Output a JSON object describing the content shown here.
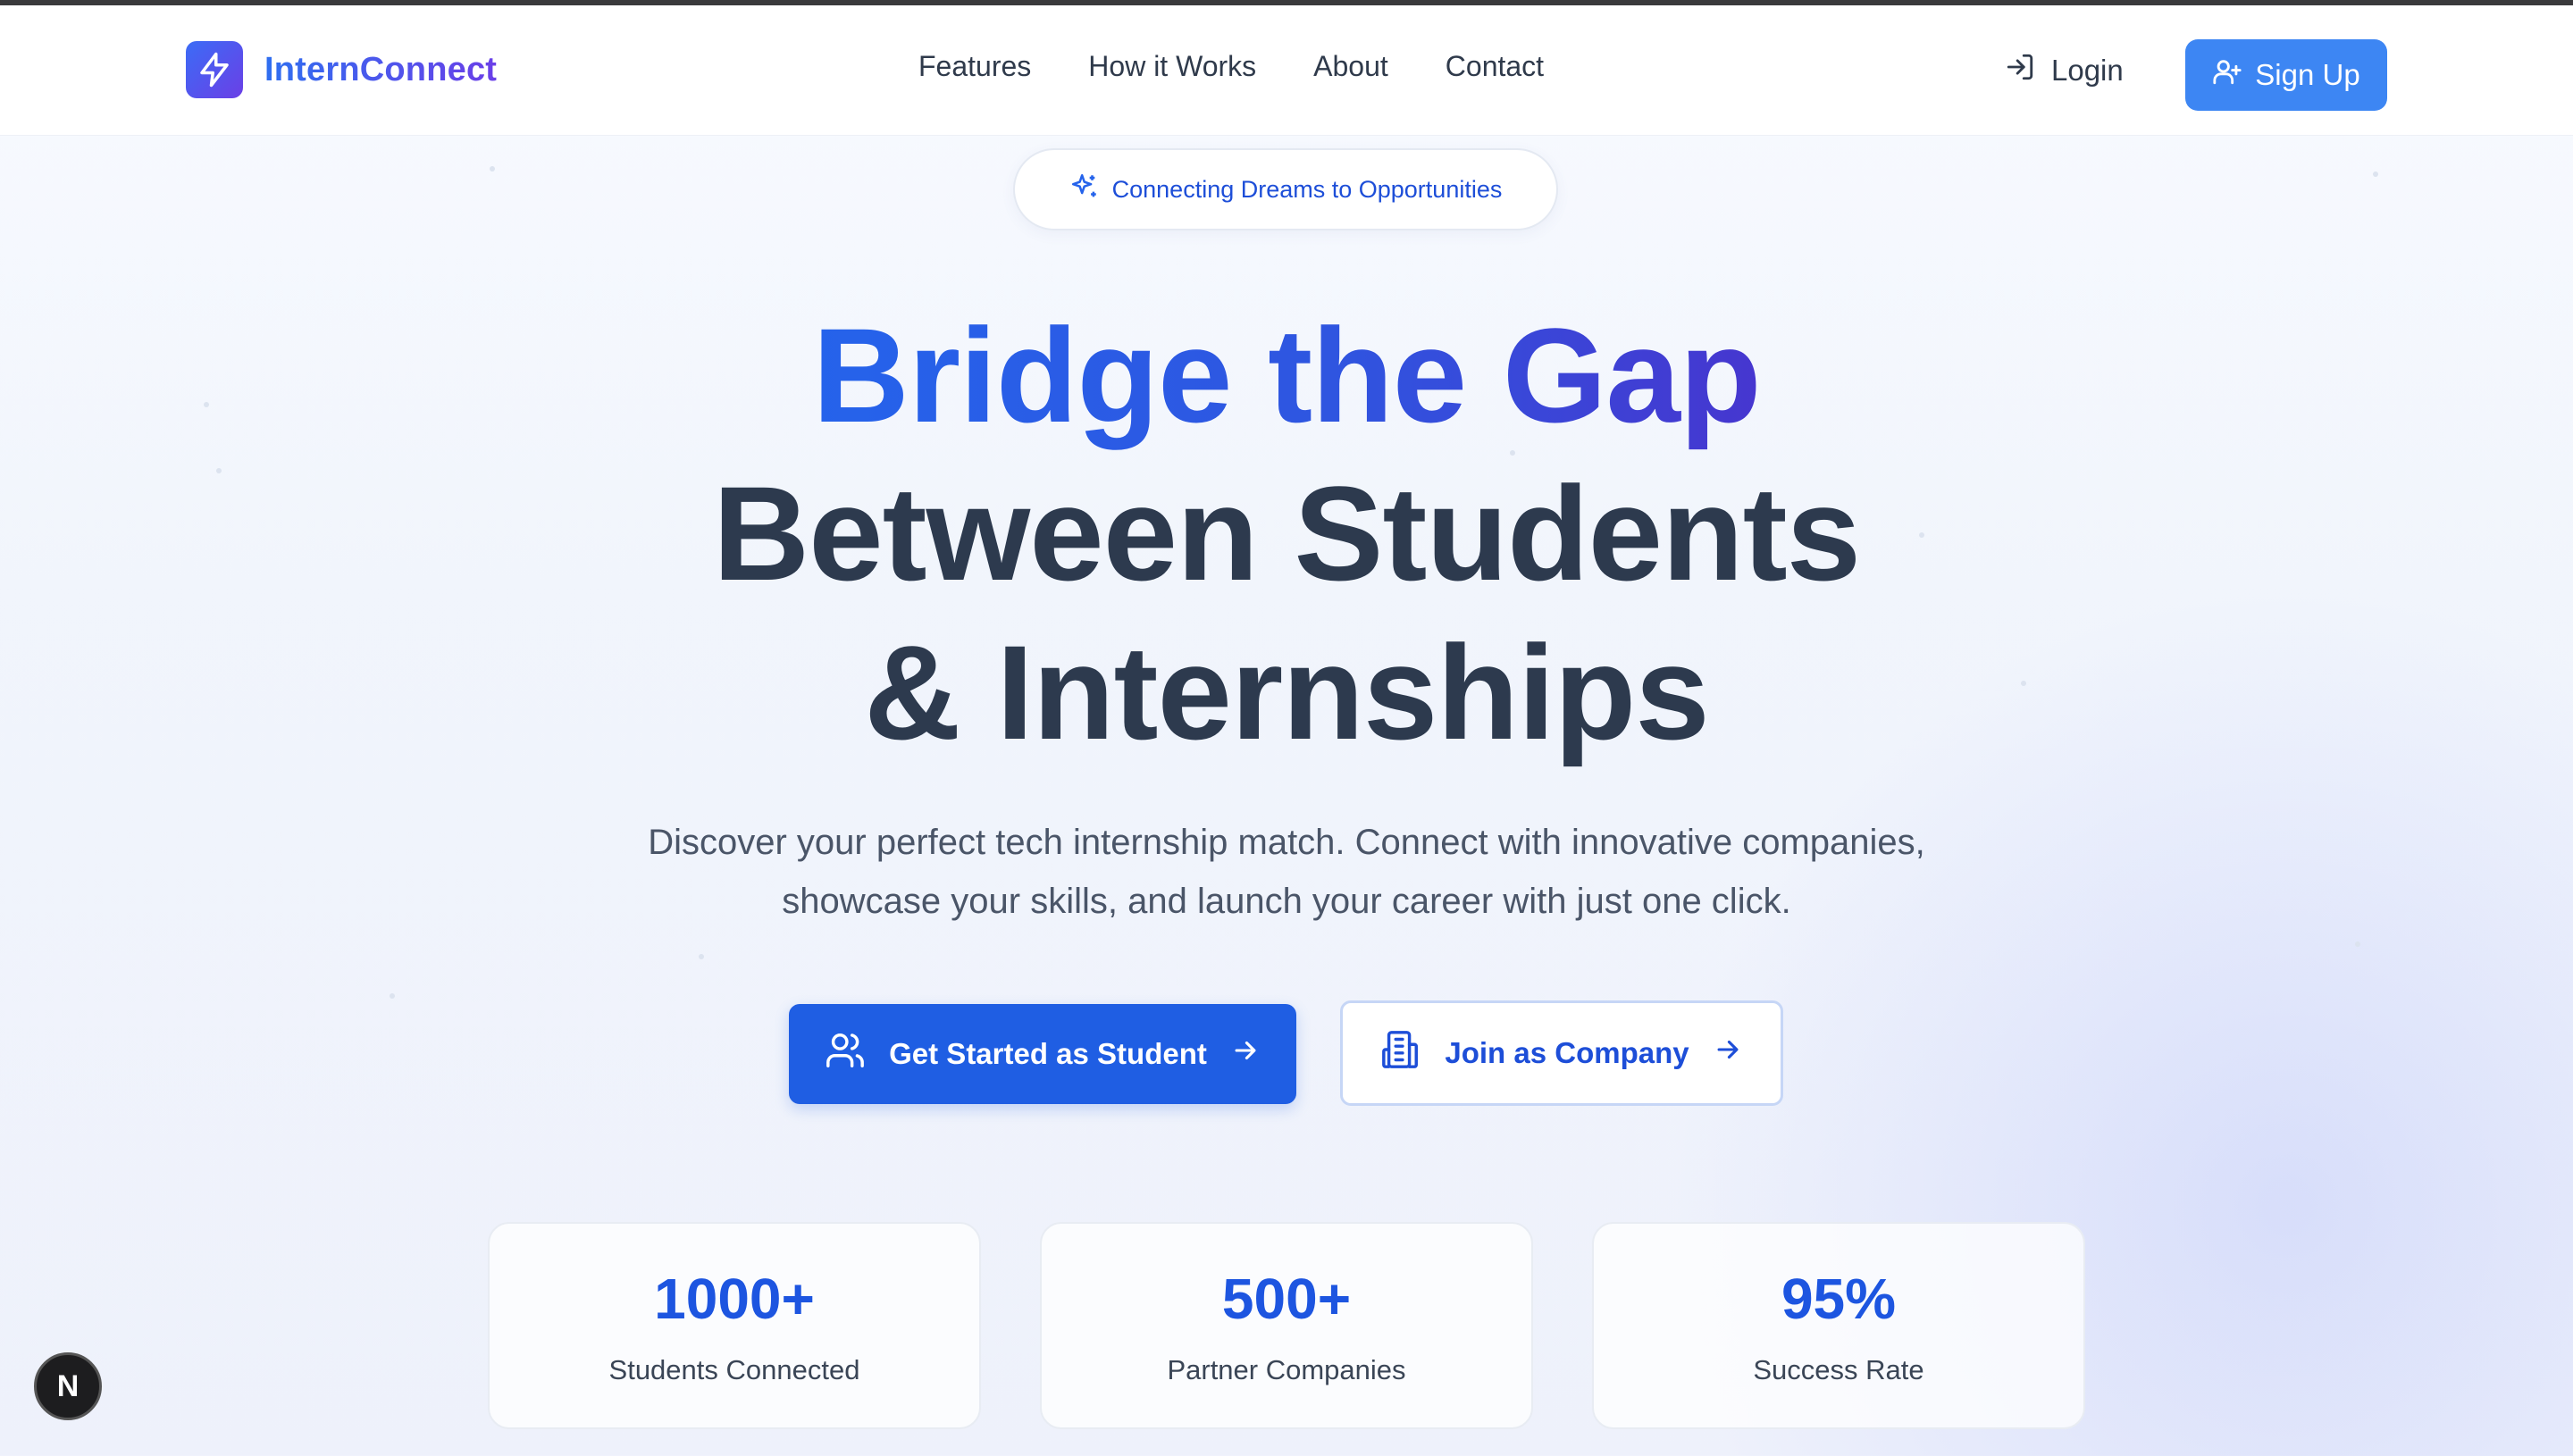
{
  "brand": {
    "name": "InternConnect",
    "logo_icon": "lightning-icon"
  },
  "nav": {
    "links": [
      "Features",
      "How it Works",
      "About",
      "Contact"
    ],
    "login_label": "Login",
    "signup_label": "Sign Up"
  },
  "hero": {
    "badge": "Connecting Dreams to Opportunities",
    "title_line1": "Bridge the Gap",
    "title_line2": "Between Students",
    "title_line3": "& Internships",
    "subtitle_line1": "Discover your perfect tech internship match. Connect with innovative companies,",
    "subtitle_line2": "showcase your skills, and launch your career with just one click."
  },
  "cta": {
    "student_label": "Get Started as Student",
    "company_label": "Join as Company"
  },
  "stats": [
    {
      "value": "1000+",
      "label": "Students Connected"
    },
    {
      "value": "500+",
      "label": "Partner Companies"
    },
    {
      "value": "95%",
      "label": "Success Rate"
    }
  ],
  "dev_badge": "N",
  "colors": {
    "primary": "#1f5ee3",
    "signup": "#3d86f3",
    "brand_gradient_start": "#2f6ff0",
    "brand_gradient_end": "#6a3fe8",
    "heading_dark": "#2d3a4e"
  }
}
